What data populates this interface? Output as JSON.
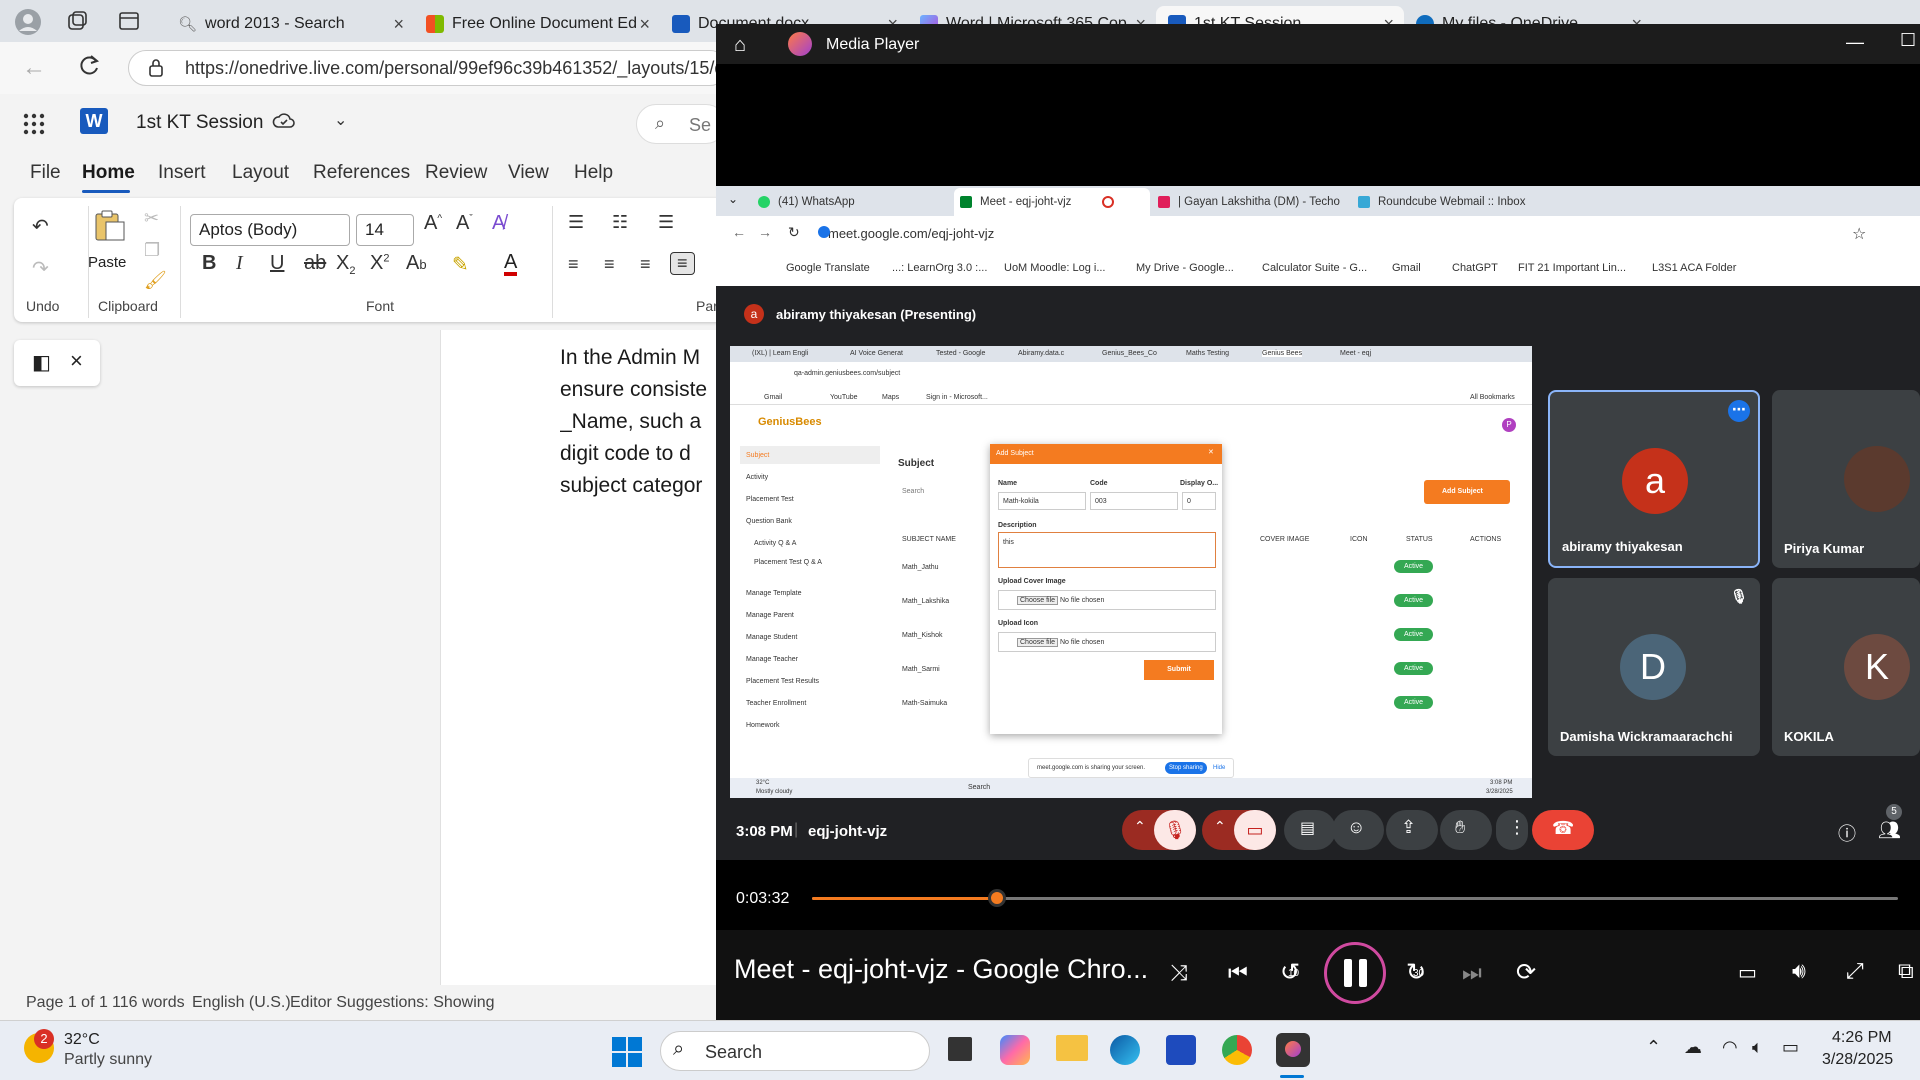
{
  "browser": {
    "tabs": [
      {
        "label": "word 2013 - Search",
        "icon": "search-icon"
      },
      {
        "label": "Free Online Document Ed",
        "icon": "tiles-icon"
      },
      {
        "label": "Document.docx",
        "icon": "word-icon"
      },
      {
        "label": "Word | Microsoft 365 Cop",
        "icon": "copilot-icon"
      },
      {
        "label": "1st KT Session",
        "icon": "word-icon"
      },
      {
        "label": "My files - OneDrive",
        "icon": "onedrive-icon"
      }
    ],
    "url": "https://onedrive.live.com/personal/99ef96c39b461352/_layouts/15/d"
  },
  "word": {
    "doc_title": "1st  KT  Session",
    "search_placeholder": "Se",
    "ribbon_tabs": [
      "File",
      "Home",
      "Insert",
      "Layout",
      "References",
      "Review",
      "View",
      "Help"
    ],
    "font_name": "Aptos (Body)",
    "font_size": "14",
    "groups": {
      "undo": "Undo",
      "clipboard": "Clipboard",
      "font": "Font",
      "para": "Par"
    },
    "paste": "Paste",
    "doc_lines": [
      "In the Admin M",
      "ensure consiste",
      "_Name, such a",
      "digit code to d",
      "subject categor"
    ],
    "status": {
      "page": "Page 1 of 1",
      "words": "116 words",
      "lang": "English (U.S.)",
      "editor": "Editor Suggestions: Showing"
    }
  },
  "media_player": {
    "title": "Media Player",
    "elapsed": "0:03:32",
    "progress": 0.17,
    "now_playing": "Meet - eqj-joht-vjz - Google Chro...",
    "skip_back": "10",
    "skip_fwd": "30"
  },
  "inner_chrome": {
    "tabs": [
      "(41) WhatsApp",
      "Meet - eqj-joht-vjz",
      "| Gayan Lakshitha (DM) - Techo",
      "Roundcube Webmail :: Inbox"
    ],
    "url": "meet.google.com/eqj-joht-vjz",
    "bookmarks": [
      "Google Translate",
      "...: LearnOrg 3.0 :...",
      "UoM Moodle: Log i...",
      "My Drive - Google...",
      "Calculator Suite - G...",
      "Gmail",
      "ChatGPT",
      "FIT 21 Important Lin...",
      "L3S1 ACA Folder"
    ]
  },
  "meet": {
    "presenter": "abiramy thiyakesan (Presenting)",
    "presenter_initial": "a",
    "time": "3:08 PM",
    "code": "eqj-joht-vjz",
    "people_count": "5",
    "participants": [
      {
        "name": "abiramy thiyakesan",
        "initial": "a",
        "color": "#c5311a"
      },
      {
        "name": "Piriya Kumar",
        "initial": "",
        "color": "#5b3a2e"
      },
      {
        "name": "Damisha Wickramaarachchi",
        "initial": "D",
        "color": "#4b6578"
      },
      {
        "name": "KOKILA",
        "initial": "K",
        "color": "#6d4a40"
      }
    ]
  },
  "shared_screen": {
    "tabs": [
      "(IXL) | Learn Engli",
      "AI Voice Generat",
      "Tested - Google",
      "Abiramy.data.c",
      "Genius_Bees_Co",
      "Maths Testing",
      "Genius Bees",
      "Meet - eqj"
    ],
    "url": "qa-admin.geniusbees.com/subject",
    "bookmarks": [
      "Gmail",
      "YouTube",
      "Maps",
      "Sign in - Microsoft...",
      "All Bookmarks"
    ],
    "logo": "GeniusBees",
    "sidebar": [
      "Subject",
      "Activity",
      "Placement Test",
      "Question Bank",
      "Activity Q & A",
      "Placement Test Q & A",
      "Manage Template",
      "Manage Parent",
      "Manage Student",
      "Manage Teacher",
      "Placement Test Results",
      "Teacher Enrollment",
      "Homework"
    ],
    "page_title": "Subject",
    "search": "Search",
    "add_btn": "Add Subject",
    "columns": [
      "SUBJECT NAME",
      "COVER IMAGE",
      "ICON",
      "STATUS",
      "ACTIONS"
    ],
    "rows": [
      "Math_Jathu",
      "Math_Lakshika",
      "Math_Kishok",
      "Math_Sarmi",
      "Math-Saimuka"
    ],
    "status": "Active",
    "modal": {
      "title": "Add Subject",
      "name_label": "Name",
      "name_value": "Math-kokila",
      "code_label": "Code",
      "code_value": "003",
      "display_label": "Display O...",
      "display_value": "0",
      "desc_label": "Description",
      "desc_value": "this",
      "cover_label": "Upload Cover Image",
      "icon_label": "Upload Icon",
      "choose": "Choose file",
      "nofile": "No file chosen",
      "submit": "Submit"
    },
    "sharing_msg": "meet.google.com is sharing your screen.",
    "stop_sharing": "Stop sharing",
    "hide": "Hide",
    "weather": "32°C",
    "weather2": "Mostly cloudy",
    "clock": "3:08 PM",
    "date": "3/28/2025"
  },
  "taskbar": {
    "temp": "32°C",
    "weather": "Partly sunny",
    "badge": "2",
    "search": "Search",
    "time": "4:26 PM",
    "date": "3/28/2025"
  },
  "colors": {
    "word_blue": "#185abd",
    "meet_red": "#ea4335",
    "orange": "#f47b20",
    "active_green": "#34a853"
  }
}
